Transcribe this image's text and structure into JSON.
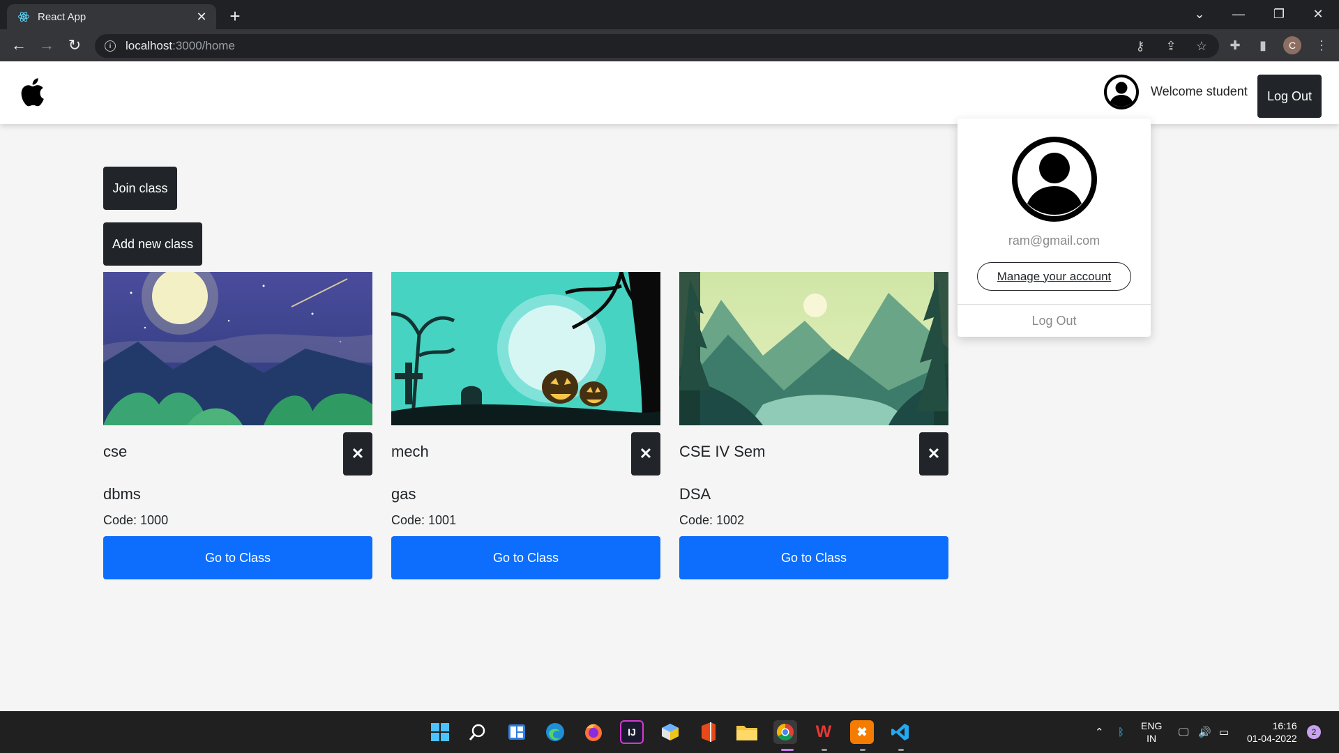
{
  "browser": {
    "tab_title": "React App",
    "url_host": "localhost",
    "url_path": ":3000/home",
    "profile_initial": "C"
  },
  "header": {
    "welcome": "Welcome student",
    "logout_label": "Log Out"
  },
  "actions": {
    "join_label": "Join class",
    "add_label": "Add new class"
  },
  "classes": [
    {
      "name": "cse",
      "subject": "dbms",
      "code": "Code: 1000",
      "go_label": "Go to Class",
      "delete_icon": "✕",
      "banner": "night-sky-moon-jungle"
    },
    {
      "name": "mech",
      "subject": "gas",
      "code": "Code: 1001",
      "go_label": "Go to Class",
      "delete_icon": "✕",
      "banner": "halloween-graveyard-pumpkins"
    },
    {
      "name": "CSE IV Sem",
      "subject": "DSA",
      "code": "Code: 1002",
      "go_label": "Go to Class",
      "delete_icon": "✕",
      "banner": "mountain-valley-river"
    }
  ],
  "dropdown": {
    "email": "ram@gmail.com",
    "manage_label": "Manage your account",
    "logout_label": "Log Out"
  },
  "taskbar": {
    "lang_line1": "ENG",
    "lang_line2": "IN",
    "time": "16:16",
    "date": "01-04-2022",
    "notification_count": "2"
  },
  "colors": {
    "primary_button": "#0d6efd",
    "dark_button": "#212529",
    "chrome_dark": "#202124"
  }
}
